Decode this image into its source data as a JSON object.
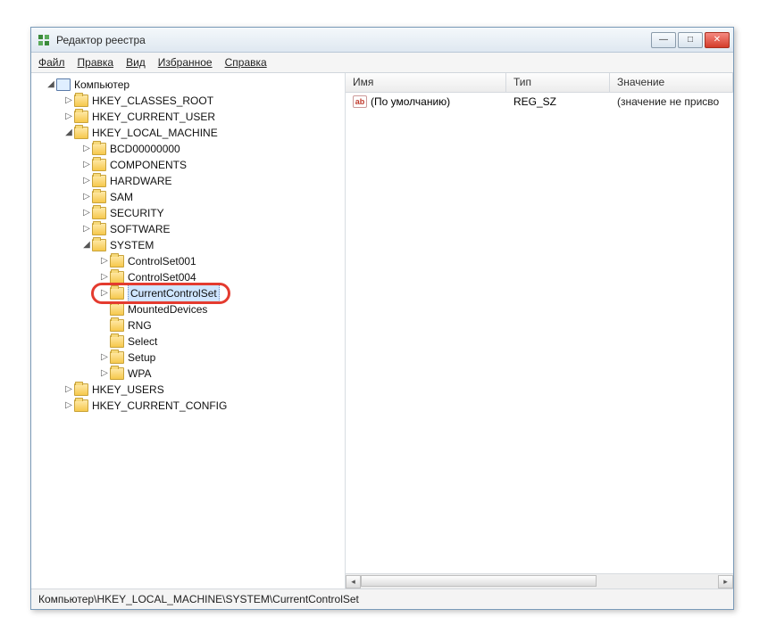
{
  "window": {
    "title": "Редактор реестра"
  },
  "menu": {
    "file": "Файл",
    "edit": "Правка",
    "view": "Вид",
    "favorites": "Избранное",
    "help": "Справка"
  },
  "tree": {
    "root": "Компьютер",
    "hives": {
      "hkcr": "HKEY_CLASSES_ROOT",
      "hkcu": "HKEY_CURRENT_USER",
      "hklm": "HKEY_LOCAL_MACHINE",
      "hku": "HKEY_USERS",
      "hkcc": "HKEY_CURRENT_CONFIG"
    },
    "hklm_children": {
      "bcd": "BCD00000000",
      "components": "COMPONENTS",
      "hardware": "HARDWARE",
      "sam": "SAM",
      "security": "SECURITY",
      "software": "SOFTWARE",
      "system": "SYSTEM"
    },
    "system_children": {
      "cs001": "ControlSet001",
      "cs004": "ControlSet004",
      "ccs": "CurrentControlSet",
      "mounted": "MountedDevices",
      "rng": "RNG",
      "select": "Select",
      "setup": "Setup",
      "wpa": "WPA"
    }
  },
  "list": {
    "columns": {
      "name": "Имя",
      "type": "Тип",
      "value": "Значение"
    },
    "rows": [
      {
        "name": "(По умолчанию)",
        "type": "REG_SZ",
        "value": "(значение не присво"
      }
    ]
  },
  "statusbar": {
    "path": "Компьютер\\HKEY_LOCAL_MACHINE\\SYSTEM\\CurrentControlSet"
  }
}
